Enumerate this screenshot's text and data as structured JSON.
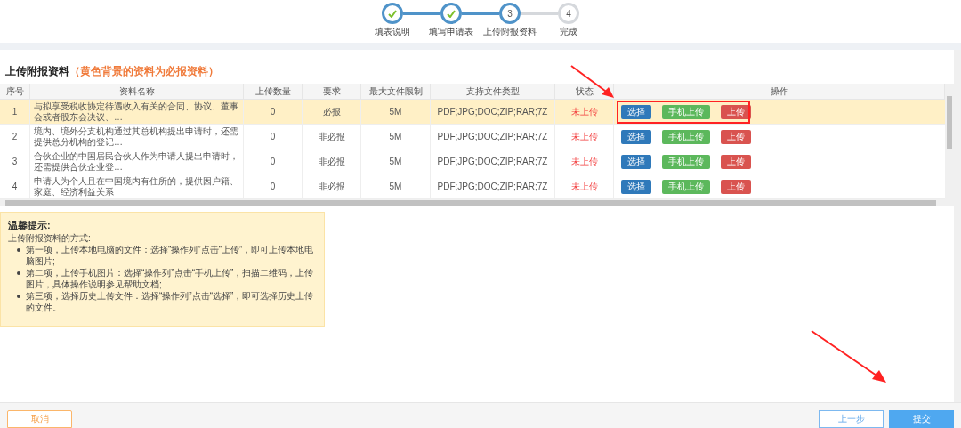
{
  "steps": [
    {
      "label": "填表说明",
      "done": true,
      "current": false
    },
    {
      "label": "填写申请表",
      "done": true,
      "current": false
    },
    {
      "number": "3",
      "label": "上传附报资料",
      "done": false,
      "current": true
    },
    {
      "number": "4",
      "label": "完成",
      "done": false,
      "current": false
    }
  ],
  "section": {
    "title": "上传附报资料",
    "note": "（黄色背景的资料为必报资料）"
  },
  "table": {
    "columns": [
      "序号",
      "资料名称",
      "上传数量",
      "要求",
      "最大文件限制",
      "支持文件类型",
      "状态",
      "操作"
    ],
    "rows": [
      {
        "index": "1",
        "name": "与拟享受税收协定待遇收入有关的合同、协议、董事会或者股东会决议、…",
        "count": "0",
        "requirement": "必报",
        "required": true,
        "max_size": "5M",
        "types": "PDF;JPG;DOC;ZIP;RAR;7Z",
        "status": "未上传",
        "actions": [
          {
            "label": "选择",
            "kind": "select"
          },
          {
            "label": "手机上传",
            "kind": "mobile"
          },
          {
            "label": "上传",
            "kind": "upload"
          }
        ]
      },
      {
        "index": "2",
        "name": "境内、境外分支机构通过其总机构提出申请时，还需提供总分机构的登记…",
        "count": "0",
        "requirement": "非必报",
        "required": false,
        "max_size": "5M",
        "types": "PDF;JPG;DOC;ZIP;RAR;7Z",
        "status": "未上传",
        "actions": [
          {
            "label": "选择",
            "kind": "select"
          },
          {
            "label": "手机上传",
            "kind": "mobile"
          },
          {
            "label": "上传",
            "kind": "upload"
          }
        ]
      },
      {
        "index": "3",
        "name": "合伙企业的中国居民合伙人作为申请人提出申请时，还需提供合伙企业登…",
        "count": "0",
        "requirement": "非必报",
        "required": false,
        "max_size": "5M",
        "types": "PDF;JPG;DOC;ZIP;RAR;7Z",
        "status": "未上传",
        "actions": [
          {
            "label": "选择",
            "kind": "select"
          },
          {
            "label": "手机上传",
            "kind": "mobile"
          },
          {
            "label": "上传",
            "kind": "upload"
          }
        ]
      },
      {
        "index": "4",
        "name": "申请人为个人且在中国境内有住所的，提供因户籍、家庭、经济利益关系",
        "count": "0",
        "requirement": "非必报",
        "required": false,
        "max_size": "5M",
        "types": "PDF;JPG;DOC;ZIP;RAR;7Z",
        "status": "未上传",
        "actions": [
          {
            "label": "选择",
            "kind": "select"
          },
          {
            "label": "手机上传",
            "kind": "mobile"
          },
          {
            "label": "上传",
            "kind": "upload"
          }
        ]
      }
    ]
  },
  "tips": {
    "title": "温馨提示:",
    "intro": "上传附报资料的方式:",
    "items": [
      "第一项，上传本地电脑的文件：选择“操作列”点击“上传”，即可上传本地电脑图片;",
      "第二项，上传手机图片：选择“操作列”点击“手机上传”，扫描二维码，上传图片，具体操作说明参见帮助文档;",
      "第三项，选择历史上传文件：选择“操作列”点击“选择”，即可选择历史上传的文件。"
    ]
  },
  "footer": {
    "cancel": "取消",
    "prev": "上一步",
    "submit": "提交"
  }
}
